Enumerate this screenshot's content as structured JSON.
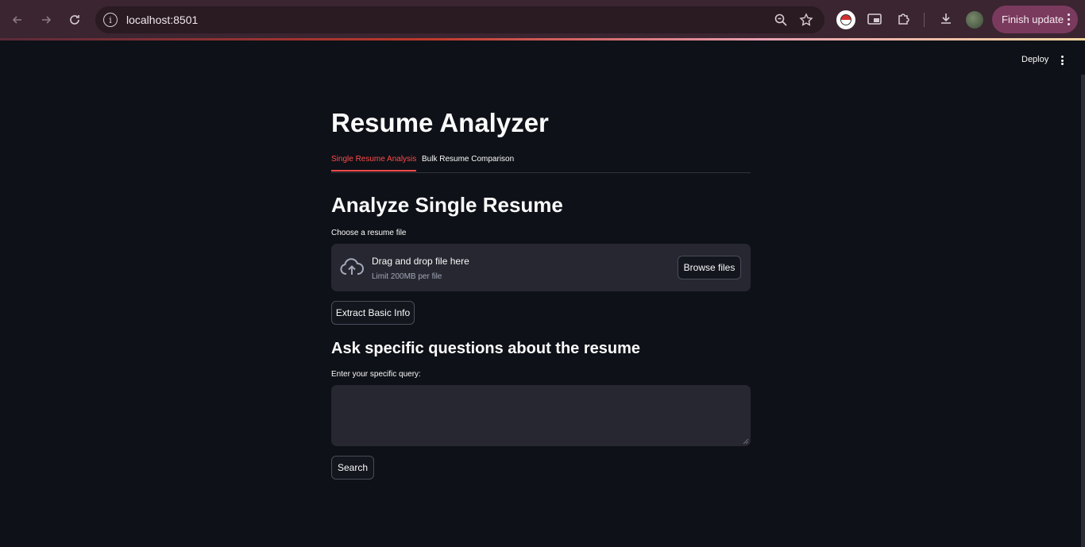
{
  "browser": {
    "url": "localhost:8501",
    "finish_update_label": "Finish update"
  },
  "header": {
    "deploy_label": "Deploy"
  },
  "main": {
    "title": "Resume Analyzer",
    "tabs": [
      {
        "label": "Single Resume Analysis",
        "active": true
      },
      {
        "label": "Bulk Resume Comparison",
        "active": false
      }
    ],
    "section_title": "Analyze Single Resume",
    "uploader": {
      "label": "Choose a resume file",
      "drag_text": "Drag and drop file here",
      "limit_text": "Limit 200MB per file",
      "browse_label": "Browse files"
    },
    "extract_button_label": "Extract Basic Info",
    "query_section_title": "Ask specific questions about the resume",
    "query_label": "Enter your specific query:",
    "query_value": "",
    "search_button_label": "Search"
  },
  "colors": {
    "background": "#0e1117",
    "accent": "#ff4b4b",
    "surface": "#262730"
  }
}
